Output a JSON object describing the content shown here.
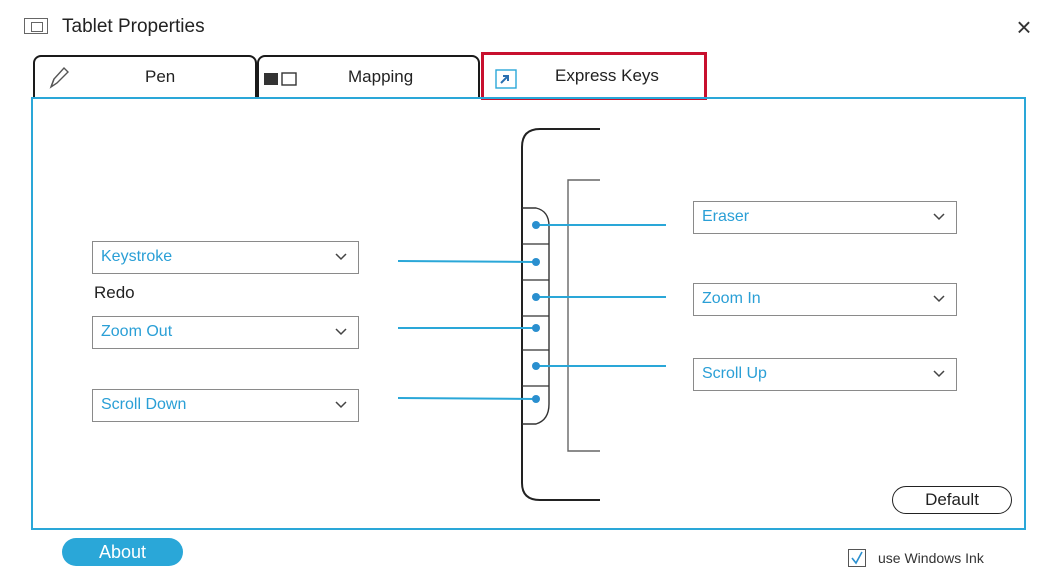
{
  "window": {
    "title": "Tablet Properties",
    "close_glyph": "×"
  },
  "tabs": [
    {
      "label": "Pen",
      "icon": "pen-icon"
    },
    {
      "label": "Mapping",
      "icon": "mapping-icon"
    },
    {
      "label": "Express Keys",
      "icon": "express-keys-icon",
      "selected": true
    }
  ],
  "express_keys": {
    "left": [
      {
        "value": "Keystroke",
        "sub_label": "Redo"
      },
      {
        "value": "Zoom Out"
      },
      {
        "value": "Scroll Down"
      }
    ],
    "right": [
      {
        "value": "Eraser"
      },
      {
        "value": "Zoom In"
      },
      {
        "value": "Scroll Up"
      }
    ]
  },
  "buttons": {
    "default": "Default",
    "about": "About"
  },
  "windows_ink": {
    "label": "use Windows Ink",
    "checked": true
  },
  "colors": {
    "accent": "#2aa7d8",
    "highlight": "#c8102e"
  }
}
